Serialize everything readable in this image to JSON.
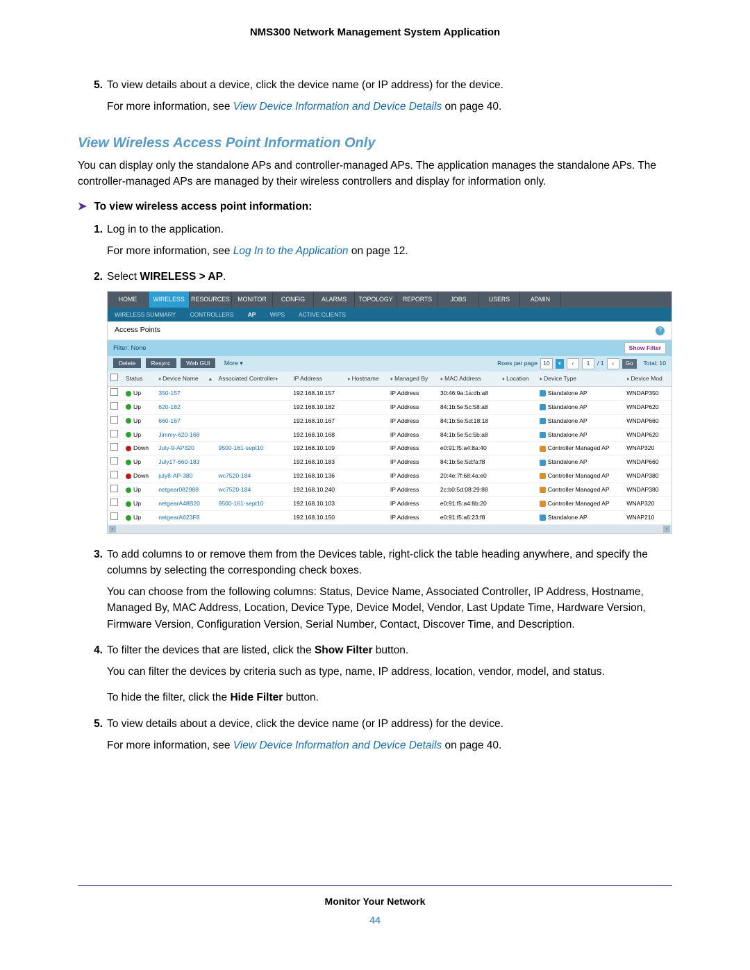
{
  "header": "NMS300 Network Management System Application",
  "pre_item": {
    "num": "5.",
    "text_a": "To view details about a device, click the device name (or IP address) for the device.",
    "text_b1": "For more information, see ",
    "link_b": "View Device Information and Device Details",
    "text_b2": " on page 40."
  },
  "h2": "View Wireless Access Point Information Only",
  "intro": "You can display only the standalone APs and controller-managed APs. The application manages the standalone APs. The controller-managed APs are managed by their wireless controllers and display for information only.",
  "proc_label": "To view wireless access point information:",
  "steps": {
    "s1": {
      "n": "1.",
      "t": "Log in to the application.",
      "fa": "For more information, see ",
      "fl": "Log In to the Application",
      "fb": " on page 12."
    },
    "s2": {
      "n": "2.",
      "pre": "Select ",
      "bold": "WIRELESS > AP",
      "post": "."
    },
    "s3": {
      "n": "3.",
      "t": "To add columns to or remove them from the Devices table, right-click the table heading anywhere, and specify the columns by selecting the corresponding check boxes.",
      "follow": "You can choose from the following columns: Status, Device Name, Associated Controller, IP Address, Hostname, Managed By, MAC Address, Location, Device Type, Device Model, Vendor, Last Update Time, Hardware Version, Firmware Version, Configuration Version, Serial Number, Contact, Discover Time, and Description."
    },
    "s4": {
      "n": "4.",
      "pre": "To filter the devices that are listed, click the ",
      "bold": "Show Filter",
      "post": " button.",
      "follow": "You can filter the devices by criteria such as type, name, IP address, location, vendor, model, and status.",
      "follow2a": "To hide the filter, click the ",
      "follow2b": "Hide Filter",
      "follow2c": " button."
    },
    "s5": {
      "n": "5.",
      "t": "To view details about a device, click the device name (or IP address) for the device.",
      "fa": "For more information, see ",
      "fl": "View Device Information and Device Details",
      "fb": " on page 40."
    }
  },
  "screenshot": {
    "nav": [
      "HOME",
      "WIRELESS",
      "RESOURCES",
      "MONITOR",
      "CONFIG",
      "ALARMS",
      "TOPOLOGY",
      "REPORTS",
      "JOBS",
      "USERS",
      "ADMIN"
    ],
    "subnav": [
      "WIRELESS SUMMARY",
      "CONTROLLERS",
      "AP",
      "WIPS",
      "ACTIVE CLIENTS"
    ],
    "section": "Access Points",
    "filter_label": "Filter: None",
    "show_filter": "Show Filter",
    "toolbar": {
      "delete": "Delete",
      "resync": "Resync",
      "webgui": "Web GUI",
      "more": "More ▾",
      "rpp_label": "Rows per page",
      "rpp_val": "10",
      "page": "1",
      "pages": "/ 1",
      "go": "Go",
      "total": "Total: 10"
    },
    "cols": [
      "Status",
      "Device Name",
      "Associated Controller",
      "IP Address",
      "Hostname",
      "Managed By",
      "MAC Address",
      "Location",
      "Device Type",
      "Device Mod"
    ],
    "rows": [
      {
        "status": "Up",
        "name": "350-157",
        "ctrl": "",
        "ip": "192.168.10.157",
        "host": "",
        "mgd": "IP Address",
        "mac": "30:46:9a:1a:db:a8",
        "loc": "",
        "dticon": "sa",
        "dtype": "Standalone AP",
        "model": "WNDAP350"
      },
      {
        "status": "Up",
        "name": "620-182",
        "ctrl": "",
        "ip": "192.168.10.182",
        "host": "",
        "mgd": "IP Address",
        "mac": "84:1b:5e:5c:58:a8",
        "loc": "",
        "dticon": "sa",
        "dtype": "Standalone AP",
        "model": "WNDAP620"
      },
      {
        "status": "Up",
        "name": "660-167",
        "ctrl": "",
        "ip": "192.168.10.167",
        "host": "",
        "mgd": "IP Address",
        "mac": "84:1b:5e:5d:18:18",
        "loc": "",
        "dticon": "sa",
        "dtype": "Standalone AP",
        "model": "WNDAP660"
      },
      {
        "status": "Up",
        "name": "Jimmy-620-168",
        "ctrl": "",
        "ip": "192.168.10.168",
        "host": "",
        "mgd": "IP Address",
        "mac": "84:1b:5e:5c:5b:a8",
        "loc": "",
        "dticon": "sa",
        "dtype": "Standalone AP",
        "model": "WNDAP620"
      },
      {
        "status": "Down",
        "name": "July-9-AP320",
        "ctrl": "9500-161-sept10",
        "ip": "192.168.10.109",
        "host": "",
        "mgd": "IP Address",
        "mac": "e0:91:f5:a4:8a:40",
        "loc": "",
        "dticon": "cm",
        "dtype": "Controller Managed AP",
        "model": "WNAP320"
      },
      {
        "status": "Up",
        "name": "July17-660-183",
        "ctrl": "",
        "ip": "192.168.10.183",
        "host": "",
        "mgd": "IP Address",
        "mac": "84:1b:5e:5d:fa:f8",
        "loc": "",
        "dticon": "sa",
        "dtype": "Standalone AP",
        "model": "WNDAP660"
      },
      {
        "status": "Down",
        "name": "july8-AP-380",
        "ctrl": "wc7520-184",
        "ip": "192.168.10.136",
        "host": "",
        "mgd": "IP Address",
        "mac": "20:4e:7f:68:4a:e0",
        "loc": "",
        "dticon": "cm",
        "dtype": "Controller Managed AP",
        "model": "WNDAP380"
      },
      {
        "status": "Up",
        "name": "netgear082988",
        "ctrl": "wc7520-184",
        "ip": "192.168.10.240",
        "host": "",
        "mgd": "IP Address",
        "mac": "2c:b0:5d:08:29:88",
        "loc": "",
        "dticon": "cm",
        "dtype": "Controller Managed AP",
        "model": "WNDAP380"
      },
      {
        "status": "Up",
        "name": "netgearA48B20",
        "ctrl": "9500-161-sept10",
        "ip": "192.168.10.103",
        "host": "",
        "mgd": "IP Address",
        "mac": "e0:91:f5:a4:8b:20",
        "loc": "",
        "dticon": "cm",
        "dtype": "Controller Managed AP",
        "model": "WNAP320"
      },
      {
        "status": "Up",
        "name": "netgearA623F8",
        "ctrl": "",
        "ip": "192.168.10.150",
        "host": "",
        "mgd": "IP Address",
        "mac": "e0:91:f5:a6:23:f8",
        "loc": "",
        "dticon": "sa",
        "dtype": "Standalone AP",
        "model": "WNAP210"
      }
    ]
  },
  "footer": {
    "title": "Monitor Your Network",
    "page": "44"
  }
}
